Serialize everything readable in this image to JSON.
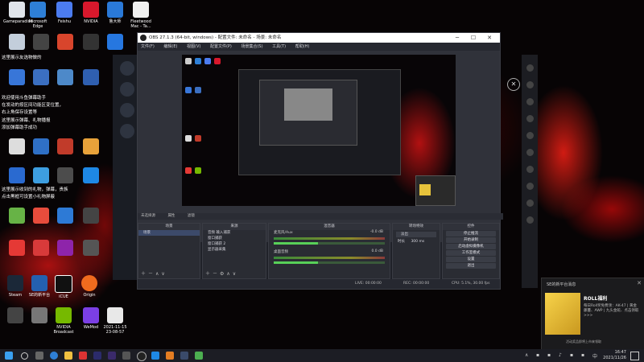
{
  "desktop": {
    "icons": [
      {
        "label": "Gameparadise",
        "color": "#e0e4ea"
      },
      {
        "label": "Microsoft Edge",
        "color": "#2e7fd6"
      },
      {
        "label": "Feishu",
        "color": "#4c7cf0"
      },
      {
        "label": "NVIDIA",
        "color": "#d8182c"
      },
      {
        "label": "鲁大师",
        "color": "#2a79d8"
      },
      {
        "label": "Fleetwood Mac - Ta...",
        "color": "#f0f0f0"
      }
    ],
    "text_lines": [
      "这里展示友选物做的",
      "欢迎使用斗鱼弹幕助手",
      "在发动的按区间功能区变位置，",
      "右上角保存设置等",
      "这里展示弹幕、礼物播报",
      "添加弹幕助手成功",
      "这里展示收到的礼物，弹幕，贵族",
      "点击黑框可设置小礼物屏蔽"
    ],
    "bottom_icons": [
      {
        "label": "Steam",
        "color": "#1b2838"
      },
      {
        "label": "SE的新平台",
        "color": "#2460b0"
      },
      {
        "label": "iCUE",
        "color": "#111"
      },
      {
        "label": "Origin",
        "color": "#f06b1e"
      },
      {
        "label": "NVIDIA Broadcast",
        "color": "#76b900"
      },
      {
        "label": "WeMod",
        "color": "#7b3fe4"
      },
      {
        "label": "2021-11-15 23-08-57",
        "color": "#e8e8e8"
      }
    ]
  },
  "obs": {
    "title": "OBS 27.1.3 (64-bit, windows) - 配置文件: 未命名 - 场景: 未命名",
    "menu": [
      "文件(F)",
      "编辑(E)",
      "视图(V)",
      "配置文件(P)",
      "场景集合(S)",
      "工具(T)",
      "帮助(H)"
    ],
    "dock_titles": [
      "场景",
      "来源",
      "混音器",
      "转场特效",
      "控件"
    ],
    "no_source": "未选择源",
    "props_button": "属性",
    "filters_button": "滤镜",
    "scenes": [
      "场景"
    ],
    "sources": [
      "音频 输入捕获",
      "窗口捕获",
      "窗口捕获 2",
      "显示器采集"
    ],
    "mixer": [
      {
        "name": "麦克风/Aux",
        "db": "-0.0 dB"
      },
      {
        "name": "桌面音频",
        "db": "0.0 dB"
      }
    ],
    "transition": {
      "type": "淡出",
      "duration_label": "时长",
      "duration": "300 ms"
    },
    "controls": [
      "停止推流",
      "开始录制",
      "启动虚拟摄像机",
      "工作室模式",
      "设置",
      "退出"
    ],
    "status": {
      "live_time": "LIVE: 00:00:00",
      "rec_time": "REC: 00:00:00",
      "cpu": "CPU: 5.1%, 30.00 fps"
    }
  },
  "notification": {
    "header": "SE的新平台消息",
    "title": "ROLL福利",
    "body": "每日Roll奖免费领：AK-47 | 黄金藤蔓、AWP | 九头金蛇、点击领取>>>",
    "footer": "活动奖品即将上市来领取"
  },
  "taskbar": {
    "time": "16:47",
    "date": "2021/11/26"
  }
}
